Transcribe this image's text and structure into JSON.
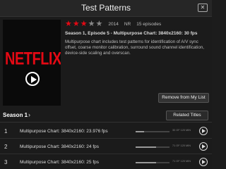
{
  "header": {
    "title": "Test Patterns",
    "close_icon": "close-icon"
  },
  "poster": {
    "logo_text": "NETFLIX",
    "play_icon": "play-icon"
  },
  "meta": {
    "rating_stars": 3,
    "rating_max": 5,
    "year": "2014",
    "maturity": "NR",
    "episodes": "15 episodes",
    "episode_line": "Season 1, Episode 5 - Multipurpose Chart: 3840x2160: 30 fps",
    "description": "Multipurpose chart includes test patterns for identification of A/V sync offset, coarse monitor calibration, surround sound channel identification, device-side scaling and overscan."
  },
  "buttons": {
    "remove": "Remove from My List",
    "related": "Related Titles"
  },
  "season": {
    "label": "Season 1",
    "chevron": "›"
  },
  "colors": {
    "accent": "#e50914"
  },
  "episodes": [
    {
      "num": "1",
      "title": "Multipurpose Chart: 3840x2160: 23.976 fps",
      "duration": "30 OF 120 MIN",
      "progress": 0.25
    },
    {
      "num": "2",
      "title": "Multipurpose Chart: 3840x2160: 24 fps",
      "duration": "71 OF 120 MIN",
      "progress": 0.6
    },
    {
      "num": "3",
      "title": "Multipurpose Chart: 3840x2160: 25 fps",
      "duration": "71 OF 120 MIN",
      "progress": 0.6
    }
  ]
}
